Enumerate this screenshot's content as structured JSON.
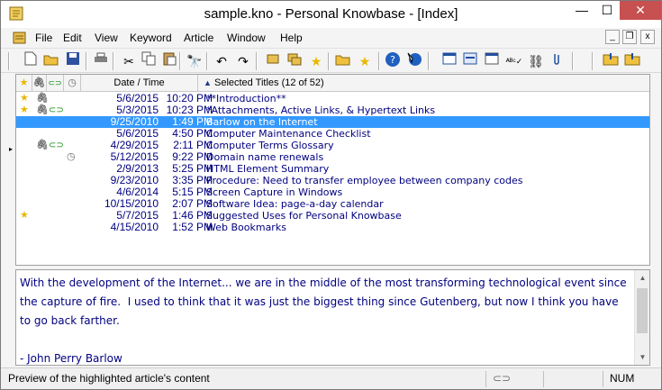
{
  "window": {
    "title": "sample.kno - Personal Knowbase - [Index]",
    "minimize": "—",
    "maximize": "☐",
    "close": "✕"
  },
  "menubar": {
    "items": [
      "File",
      "Edit",
      "View",
      "Keyword",
      "Article",
      "Window",
      "Help"
    ],
    "mdi_minimize": "_",
    "mdi_restore": "❐",
    "mdi_close": "x"
  },
  "toolbar": {
    "icons": [
      "new-icon",
      "open-icon",
      "save-icon",
      "print-icon",
      "cut-icon",
      "copy-icon",
      "paste-icon",
      "find-icon",
      "undo-icon",
      "redo-icon",
      "keyword-icon",
      "filter-icon",
      "star-icon",
      "folder-icon",
      "favorite-icon",
      "help-icon",
      "context-help-icon",
      "layout-icon",
      "window-icon",
      "calendar-icon",
      "spellcheck-icon",
      "hyperlink-icon",
      "attach-icon",
      "import-icon",
      "export-icon"
    ]
  },
  "list": {
    "header": {
      "date_time": "Date / Time",
      "titles": "Selected Titles (12 of 52)",
      "sort_arrow": "▲"
    },
    "rows": [
      {
        "star": true,
        "clip": true,
        "link": false,
        "clock": false,
        "date": "5/6/2015",
        "time": "10:20 PM",
        "title": "**Introduction**",
        "selected": false
      },
      {
        "star": true,
        "clip": true,
        "link": true,
        "clock": false,
        "date": "5/3/2015",
        "time": "10:23 PM",
        "title": "*Attachments, Active Links, & Hypertext Links",
        "selected": false
      },
      {
        "star": false,
        "clip": false,
        "link": false,
        "clock": false,
        "date": "9/25/2010",
        "time": "1:49 PM",
        "title": "Barlow on the Internet",
        "selected": true
      },
      {
        "star": false,
        "clip": false,
        "link": false,
        "clock": false,
        "date": "5/6/2015",
        "time": "4:50 PM",
        "title": "Computer Maintenance Checklist",
        "selected": false
      },
      {
        "star": false,
        "clip": true,
        "link": true,
        "clock": false,
        "date": "4/29/2015",
        "time": "2:11 PM",
        "title": "Computer Terms Glossary",
        "selected": false
      },
      {
        "star": false,
        "clip": false,
        "link": false,
        "clock": true,
        "date": "5/12/2015",
        "time": "9:22 PM",
        "title": "Domain name renewals",
        "selected": false
      },
      {
        "star": false,
        "clip": false,
        "link": false,
        "clock": false,
        "date": "2/9/2013",
        "time": "5:25 PM",
        "title": "HTML Element Summary",
        "selected": false
      },
      {
        "star": false,
        "clip": false,
        "link": false,
        "clock": false,
        "date": "9/23/2010",
        "time": "3:35 PM",
        "title": "Procedure: Need to transfer employee between company codes",
        "selected": false
      },
      {
        "star": false,
        "clip": false,
        "link": false,
        "clock": false,
        "date": "4/6/2014",
        "time": "5:15 PM",
        "title": "Screen Capture in Windows",
        "selected": false
      },
      {
        "star": false,
        "clip": false,
        "link": false,
        "clock": false,
        "date": "10/15/2010",
        "time": "2:07 PM",
        "title": "Software Idea: page-a-day calendar",
        "selected": false
      },
      {
        "star": true,
        "clip": false,
        "link": false,
        "clock": false,
        "date": "5/7/2015",
        "time": "1:46 PM",
        "title": "Suggested Uses for Personal Knowbase",
        "selected": false
      },
      {
        "star": false,
        "clip": false,
        "link": false,
        "clock": false,
        "date": "4/15/2010",
        "time": "1:52 PM",
        "title": "Web Bookmarks",
        "selected": false
      }
    ]
  },
  "preview": {
    "text": "With the development of the Internet... we are in the middle of the most transforming technological event since the capture of fire.  I used to think that it was just the biggest thing since Gutenberg, but now I think you have to go back farther.\n\n- John Perry Barlow"
  },
  "statusbar": {
    "text": "Preview of the highlighted article's content",
    "num": "NUM"
  },
  "colors": {
    "selection": "#3399ff",
    "list_text": "#000080",
    "close_button": "#c75050"
  }
}
